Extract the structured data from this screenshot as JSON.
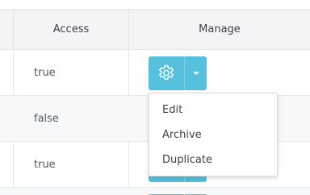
{
  "table": {
    "columns": [
      {
        "label": "Access"
      },
      {
        "label": "Manage"
      }
    ],
    "rows": [
      {
        "access": "true"
      },
      {
        "access": "false"
      },
      {
        "access": "true"
      }
    ]
  },
  "manage": {
    "main_icon": "gear-icon",
    "caret_icon": "caret-down-icon",
    "button_color": "#55c1dc"
  },
  "dropdown": {
    "items": [
      {
        "label": "Edit"
      },
      {
        "label": "Archive"
      },
      {
        "label": "Duplicate"
      }
    ]
  }
}
